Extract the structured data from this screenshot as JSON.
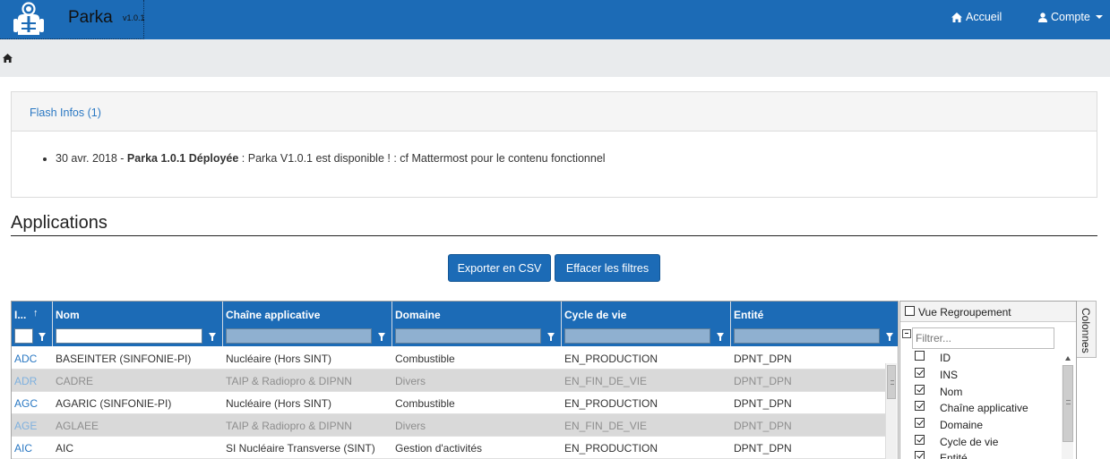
{
  "navbar": {
    "brand": "Parka",
    "version": "v1.0.1",
    "accueil": "Accueil",
    "compte": "Compte",
    "bg_color": "#1c6bb6"
  },
  "breadcrumb": {
    "icon": "home-icon"
  },
  "flash": {
    "title": "Flash Infos (1)",
    "item": {
      "date": "30 avr. 2018 - ",
      "headline": "Parka 1.0.1 Déployée",
      "text": " : Parka V1.0.1 est disponible ! : cf Mattermost pour le contenu fonctionnel"
    }
  },
  "section": {
    "title": "Applications"
  },
  "buttons": {
    "export": "Exporter en CSV",
    "clear": "Effacer les filtres"
  },
  "grid": {
    "columns": [
      "I...",
      "Nom",
      "Chaîne applicative",
      "Domaine",
      "Cycle de vie",
      "Entité"
    ],
    "sort_indicator": "↑",
    "rows": [
      {
        "id": "ADC",
        "nom": "BASEINTER (SINFONIE-PI)",
        "chaine": "Nucléaire (Hors SINT)",
        "domaine": "Combustible",
        "cycle": "EN_PRODUCTION",
        "entite": "DPNT_DPN"
      },
      {
        "id": "ADR",
        "nom": "CADRE",
        "chaine": "TAIP & Radiopro & DIPNN",
        "domaine": "Divers",
        "cycle": "EN_FIN_DE_VIE",
        "entite": "DPNT_DPN"
      },
      {
        "id": "AGC",
        "nom": "AGARIC (SINFONIE-PI)",
        "chaine": "Nucléaire (Hors SINT)",
        "domaine": "Combustible",
        "cycle": "EN_PRODUCTION",
        "entite": "DPNT_DPN"
      },
      {
        "id": "AGE",
        "nom": "AGLAEE",
        "chaine": "TAIP & Radiopro & DIPNN",
        "domaine": "Divers",
        "cycle": "EN_FIN_DE_VIE",
        "entite": "DPNT_DPN"
      },
      {
        "id": "AIC",
        "nom": "AIC",
        "chaine": "SI Nucléaire Transverse (SINT)",
        "domaine": "Gestion d'activités",
        "cycle": "EN_PRODUCTION",
        "entite": "DPNT_DPN"
      }
    ]
  },
  "side_panel": {
    "group_label": "Vue Regroupement",
    "filter_placeholder": "Filtrer...",
    "tab_label": "Colonnes",
    "columns": [
      {
        "label": "ID",
        "checked": false
      },
      {
        "label": "INS",
        "checked": true
      },
      {
        "label": "Nom",
        "checked": true
      },
      {
        "label": "Chaîne applicative",
        "checked": true
      },
      {
        "label": "Domaine",
        "checked": true
      },
      {
        "label": "Cycle de vie",
        "checked": true
      },
      {
        "label": "Entité",
        "checked": true
      }
    ]
  }
}
